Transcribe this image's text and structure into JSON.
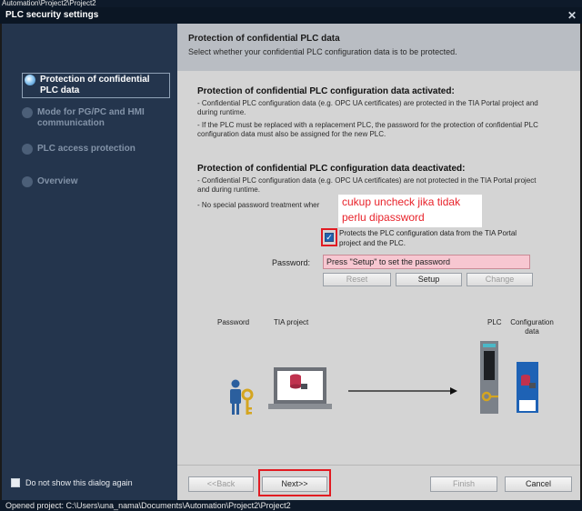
{
  "app_strip": {
    "text": "Automation\\Project2\\Project2"
  },
  "dialog": {
    "title": "PLC security settings"
  },
  "sidebar": {
    "items": [
      {
        "label": "Protection of confidential PLC data"
      },
      {
        "label": "Mode for PG/PC and HMI communication"
      },
      {
        "label": "PLC access protection"
      },
      {
        "label": "Overview"
      }
    ],
    "dont_show_label": "Do not show this dialog again"
  },
  "header": {
    "title": "Protection of confidential PLC data",
    "subtitle": "Select whether your confidential PLC configuration data is to be protected."
  },
  "activated": {
    "title": "Protection of confidential PLC configuration data activated:",
    "line1": "- Confidential PLC configuration data (e.g. OPC UA certificates) are protected in the TIA Portal project and during runtime.",
    "line2": "- If the PLC must be replaced with a replacement PLC, the password for the protection of confidential PLC configuration data must also be assigned for the new PLC."
  },
  "deactivated": {
    "title": "Protection of confidential PLC configuration data deactivated:",
    "line1": "- Confidential PLC configuration data (e.g. OPC UA certificates) are not protected in the TIA Portal project and during runtime.",
    "line2": "- No special password treatment wher"
  },
  "annotation": {
    "text": "cukup uncheck jika tidak perlu dipassword"
  },
  "protect": {
    "label": "Protects the PLC configuration data from the TIA Portal project and the PLC.",
    "checked": true
  },
  "password": {
    "label": "Password:",
    "value": "Press \"Setup\" to set the password"
  },
  "buttons": {
    "reset": "Reset",
    "setup": "Setup",
    "change": "Change"
  },
  "diagram": {
    "password_label": "Password",
    "tia_label": "TIA project",
    "plc_label": "PLC",
    "config_label": "Configuration data"
  },
  "nav": {
    "back": "<<Back",
    "next": "Next>>",
    "finish": "Finish",
    "cancel": "Cancel"
  },
  "status": {
    "text": "Opened project:    C:\\Users\\una_nama\\Documents\\Automation\\Project2\\Project2"
  },
  "colors": {
    "sidebar_bg": "#24354d",
    "content_bg": "#d4d4d4",
    "highlight_red": "#e11b22",
    "password_field_bg": "#f7c7d1"
  }
}
